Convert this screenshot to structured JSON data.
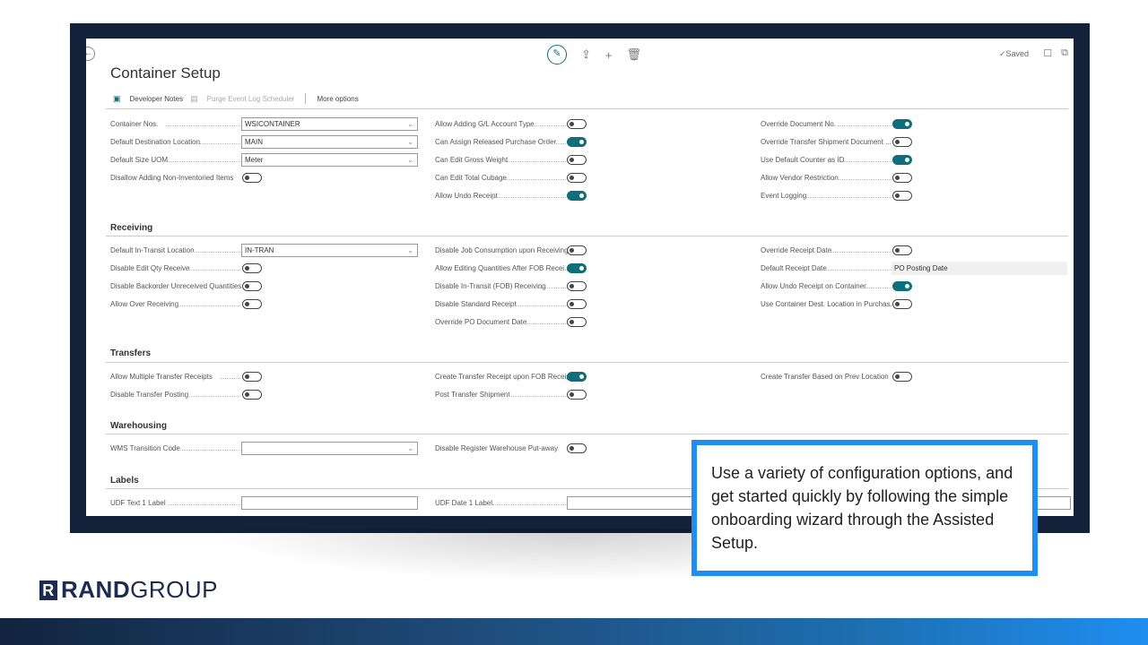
{
  "window": {
    "saved_text": "✓Saved"
  },
  "page": {
    "title": "Container Setup"
  },
  "actions": {
    "developer_notes": "Developer Notes",
    "purge": "Purge Event Log Scheduler",
    "more": "More options"
  },
  "sections": {
    "receiving": "Receiving",
    "transfers": "Transfers",
    "warehousing": "Warehousing",
    "labels": "Labels"
  },
  "general": {
    "container_nos": {
      "label": "Container Nos.",
      "value": "WSICONTAINER"
    },
    "default_dest": {
      "label": "Default Destination Location",
      "value": "MAIN"
    },
    "default_uom": {
      "label": "Default Size UOM",
      "value": "Meter"
    },
    "disallow_noninv": {
      "label": "Disallow Adding Non-Inventoried Items"
    },
    "allow_gl": {
      "label": "Allow Adding G/L Account Type"
    },
    "can_assign": {
      "label": "Can Assign Released Purchase Order"
    },
    "edit_gross": {
      "label": "Can Edit Gross Weight"
    },
    "edit_cubage": {
      "label": "Can Edit Total Cubage"
    },
    "undo_receipt": {
      "label": "Allow Undo Receipt"
    },
    "override_doc": {
      "label": "Override Document No."
    },
    "override_transfer": {
      "label": "Override Transfer Shipment Document ..."
    },
    "default_counter": {
      "label": "Use Default Counter as ID"
    },
    "vendor_restriction": {
      "label": "Allow Vendor Restriction"
    },
    "event_logging": {
      "label": "Event Logging"
    }
  },
  "receiving": {
    "intransit_loc": {
      "label": "Default In-Transit Location",
      "value": "IN-TRAN"
    },
    "disable_edit_qty": {
      "label": "Disable Edit Qty Receive"
    },
    "disable_backorder": {
      "label": "Disable Backorder Unreceived Quantities"
    },
    "over_receiving": {
      "label": "Allow Over Receiving"
    },
    "disable_job": {
      "label": "Disable Job Consumption upon Receiving"
    },
    "allow_editing_fob": {
      "label": "Allow Editing Quantities After FOB Recei..."
    },
    "disable_intransit": {
      "label": "Disable In-Transit (FOB) Receiving"
    },
    "disable_standard": {
      "label": "Disable Standard Receipt"
    },
    "override_po_date": {
      "label": "Override PO Document Date"
    },
    "override_receipt_date": {
      "label": "Override Receipt Date"
    },
    "default_receipt_date": {
      "label": "Default Receipt Date",
      "value": "PO Posting Date"
    },
    "undo_on_container": {
      "label": "Allow Undo Receipt on Container"
    },
    "use_dest_loc": {
      "label": "Use Container Dest. Location in Purchas..."
    }
  },
  "transfers": {
    "multiple_receipts": {
      "label": "Allow Multiple Transfer Receipts"
    },
    "disable_posting": {
      "label": "Disable Transfer Posting"
    },
    "create_on_fob": {
      "label": "Create Transfer Receipt upon FOB Receipt"
    },
    "post_shipment": {
      "label": "Post Transfer Shipment"
    },
    "based_on_prev": {
      "label": "Create Transfer Based on Prev Location"
    }
  },
  "warehousing": {
    "wms_code": {
      "label": "WMS Transition Code",
      "value": ""
    },
    "disable_putaway": {
      "label": "Disable Register Warehouse Put-away"
    }
  },
  "labels": {
    "udf_text_1": {
      "label": "UDF Text 1 Label",
      "value": ""
    },
    "udf_date_1": {
      "label": "UDF Date 1 Label",
      "value": ""
    }
  },
  "callout": {
    "text": " Use a variety of configuration options, and get started quickly by following the simple onboarding wizard through the Assisted Setup."
  },
  "brand": {
    "rand": "RAND",
    "group": "GROUP"
  },
  "colors": {
    "accent": "#0e6f7c",
    "callout_border": "#1e8ef0",
    "frame": "#14213b"
  }
}
